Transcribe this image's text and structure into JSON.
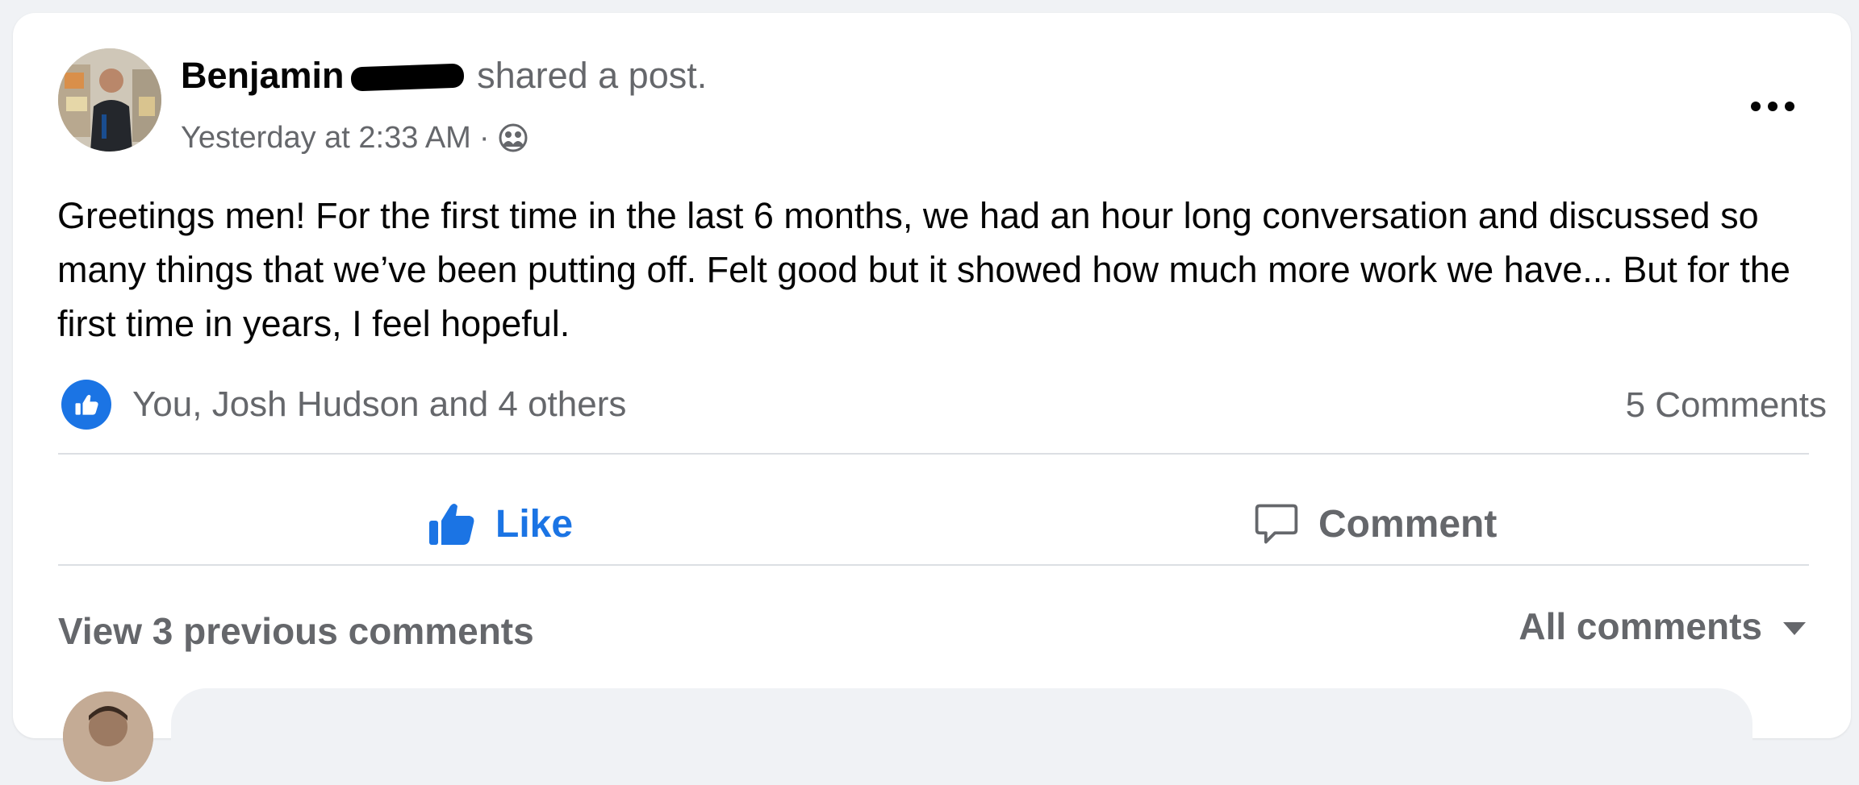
{
  "post": {
    "author_name": "Benjamin",
    "shared_text": "shared a post.",
    "timestamp": "Yesterday at 2:33 AM",
    "separator": "·",
    "privacy_icon": "friends-icon",
    "body": "Greetings men! For the first time in the last 6 months, we had an hour long conversation and discussed so many things that we’ve been putting off. Felt good but it showed how much more work we have... But for the first time in years, I feel hopeful."
  },
  "reactions": {
    "icon": "like-reaction-icon",
    "summary": "You, Josh Hudson and 4 others",
    "comments_count": "5 Comments"
  },
  "actions": {
    "like_label": "Like",
    "comment_label": "Comment"
  },
  "comments": {
    "view_previous": "View 3 previous comments",
    "filter_label": "All comments"
  },
  "colors": {
    "accent": "#1b74e4",
    "secondary_text": "#65676b",
    "background": "#f0f2f5"
  }
}
